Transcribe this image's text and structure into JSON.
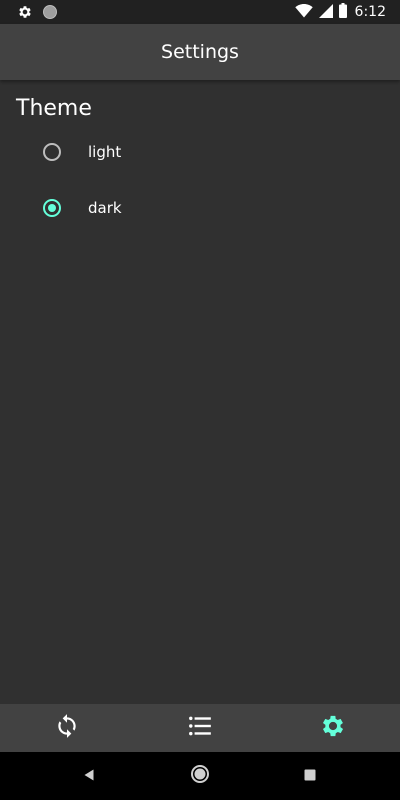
{
  "status_bar": {
    "time": "6:12",
    "left_icons": [
      "gear-icon",
      "circle-icon"
    ],
    "right_icons": [
      "wifi-icon",
      "signal-icon",
      "battery-icon"
    ]
  },
  "app_bar": {
    "title": "Settings"
  },
  "theme_section": {
    "heading": "Theme",
    "options": [
      {
        "label": "light",
        "selected": false
      },
      {
        "label": "dark",
        "selected": true
      }
    ]
  },
  "bottom_nav": {
    "items": [
      {
        "icon": "sync-icon",
        "active": false
      },
      {
        "icon": "list-icon",
        "active": false
      },
      {
        "icon": "settings-icon",
        "active": true
      }
    ]
  },
  "system_nav": {
    "buttons": [
      "back-icon",
      "home-icon",
      "recents-icon"
    ]
  },
  "colors": {
    "background": "#303030",
    "app_bar": "#424242",
    "status_bar": "#212121",
    "accent": "#64ffda",
    "text": "#ffffff",
    "inactive_radio": "#bdbdbd",
    "system_nav": "#000000"
  }
}
